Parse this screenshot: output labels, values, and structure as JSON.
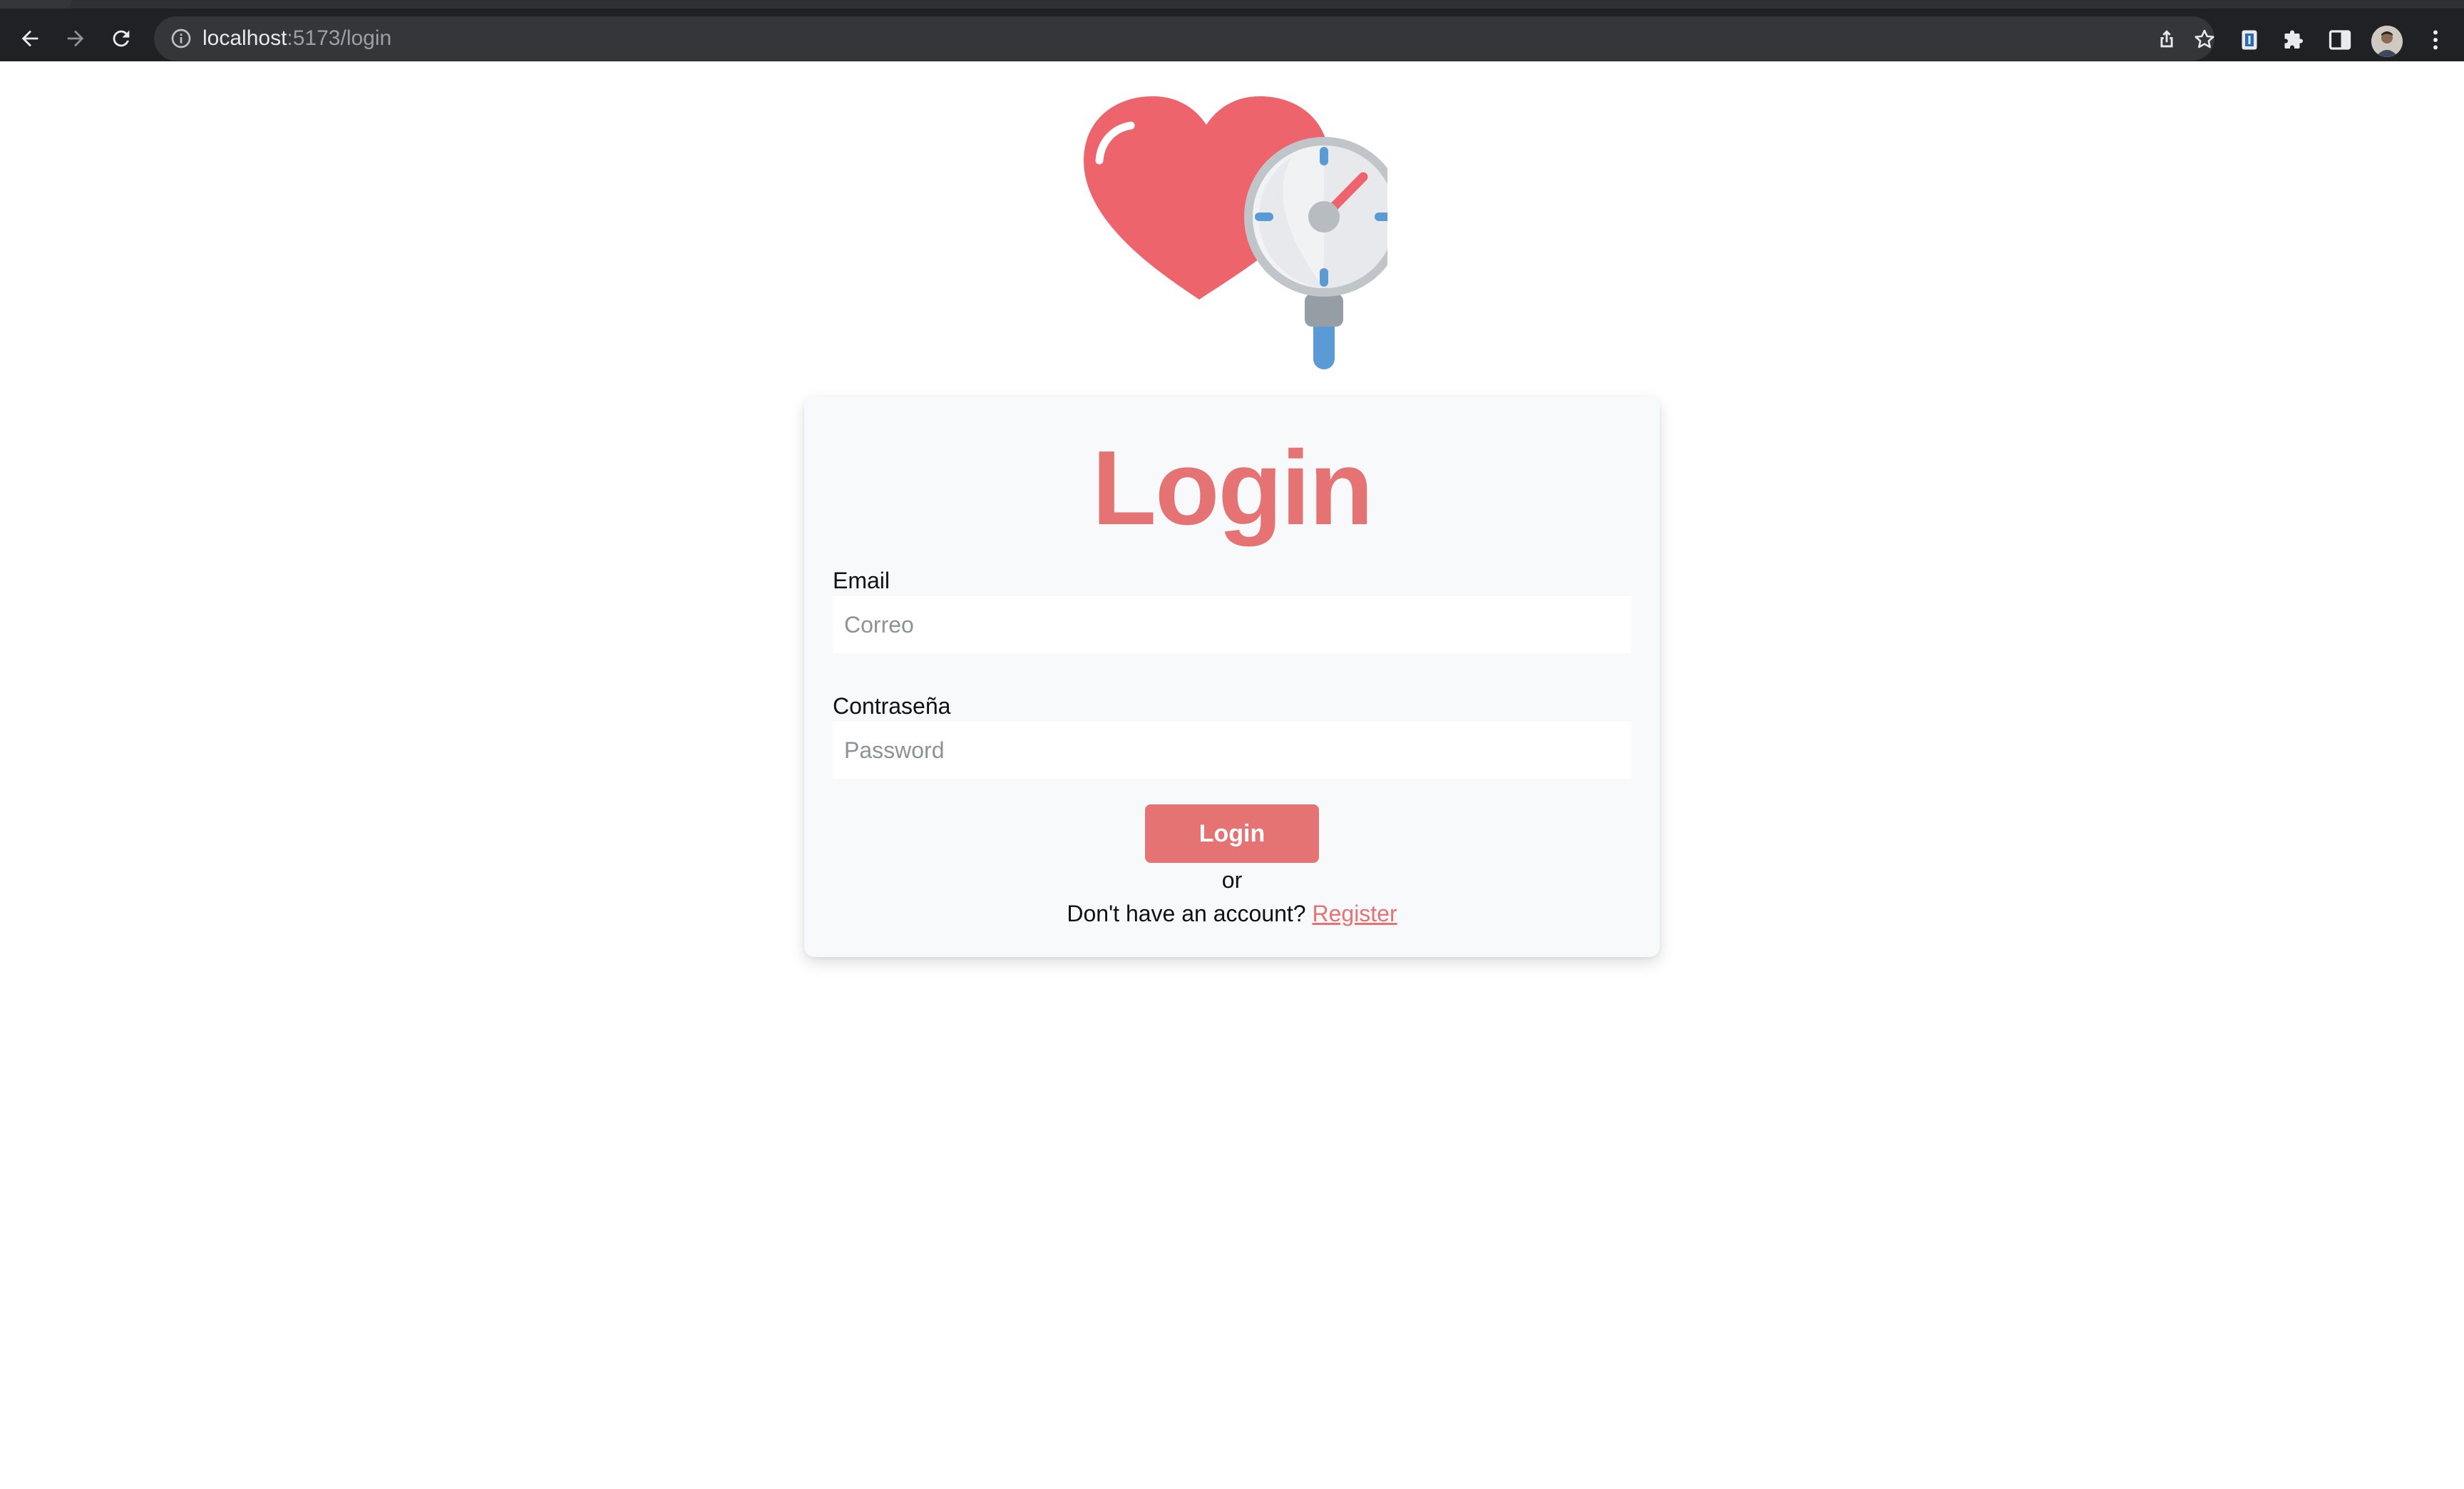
{
  "browser": {
    "url_host": "localhost",
    "url_path": ":5173/login",
    "icons": [
      "back-arrow-icon",
      "forward-arrow-icon",
      "reload-icon",
      "info-icon",
      "share-icon",
      "bookmark-star-icon",
      "extension-icon",
      "puzzle-icon",
      "side-panel-icon",
      "profile-avatar",
      "kebab-menu-icon"
    ]
  },
  "colors": {
    "accent": "#e57373",
    "card_bg": "#f8f9fa",
    "chrome_bg": "#202124"
  },
  "login": {
    "title": "Login",
    "email_label": "Email",
    "email_placeholder": "Correo",
    "password_label": "Contraseña",
    "password_placeholder": "Password",
    "submit_label": "Login",
    "or_text": "or",
    "register_prompt": "Don't have an account?",
    "register_link": "Register"
  }
}
